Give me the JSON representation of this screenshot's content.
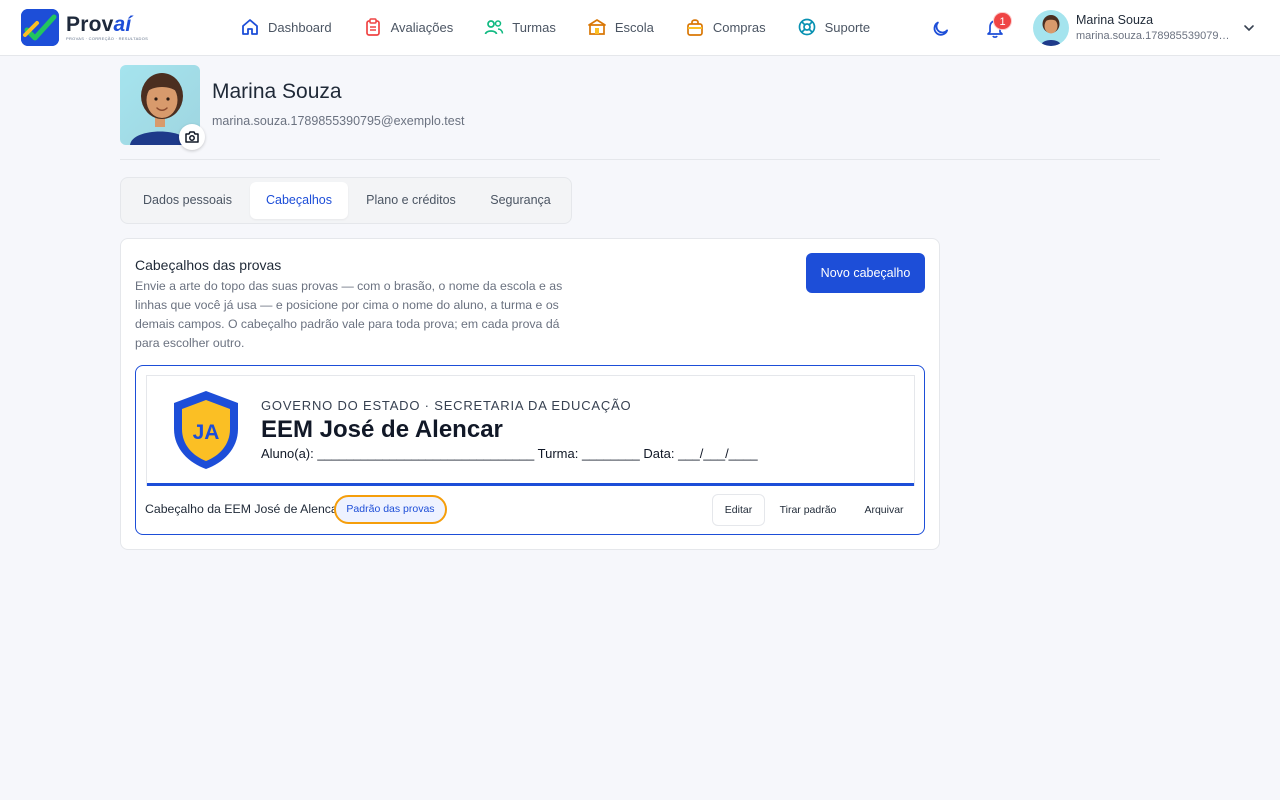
{
  "app": {
    "name_main": "Prov",
    "name_accent": "aí",
    "tagline": "PROVAS · CORREÇÃO · RESULTADOS"
  },
  "nav": {
    "items": [
      {
        "label": "Dashboard",
        "icon": "home-icon"
      },
      {
        "label": "Avaliações",
        "icon": "clipboard-icon"
      },
      {
        "label": "Turmas",
        "icon": "users-icon"
      },
      {
        "label": "Escola",
        "icon": "school-icon"
      },
      {
        "label": "Compras",
        "icon": "shopping-bag-icon"
      },
      {
        "label": "Suporte",
        "icon": "lifebuoy-icon"
      }
    ]
  },
  "notifications": {
    "count": "1"
  },
  "user": {
    "name": "Marina Souza",
    "email": "marina.souza.1789855390795@exemplo.test"
  },
  "tabs": [
    {
      "label": "Dados pessoais",
      "active": false
    },
    {
      "label": "Cabeçalhos",
      "active": true
    },
    {
      "label": "Plano e créditos",
      "active": false
    },
    {
      "label": "Segurança",
      "active": false
    }
  ],
  "card": {
    "title": "Cabeçalhos das provas",
    "description": "Envie a arte do topo das suas provas — com o brasão, o nome da escola e as linhas que você já usa — e posicione por cima o nome do aluno, a turma e os demais campos. O cabeçalho padrão vale para toda prova; em cada prova dá para escolher outro.",
    "new_button": "Novo cabeçalho"
  },
  "header_item": {
    "preview": {
      "crest_initials": "JA",
      "government": "GOVERNO DO ESTADO · SECRETARIA DA EDUCAÇÃO",
      "school": "EEM José de Alencar",
      "fields": "Aluno(a): ______________________________ Turma: ________ Data: ___/___/____"
    },
    "label": "Cabeçalho da EEM José de Alencar",
    "default_badge": "Padrão das provas",
    "actions": {
      "edit": "Editar",
      "unset_default": "Tirar padrão",
      "archive": "Arquivar"
    }
  },
  "colors": {
    "brand": "#1d4ed8",
    "badge_outline": "#f59e0b",
    "notification": "#ef4444",
    "crest_gold": "#fbbf24"
  }
}
